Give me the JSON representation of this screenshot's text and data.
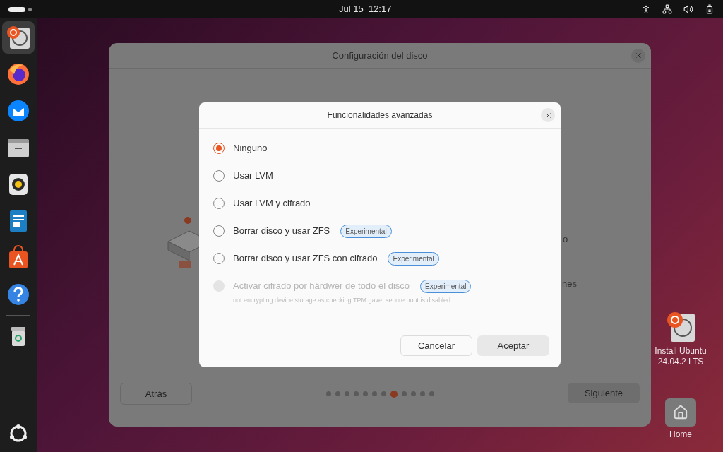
{
  "top_bar": {
    "clock": "Jul 15  12:17"
  },
  "dock": {
    "items": [
      {
        "kind": "installer",
        "selected": true
      },
      {
        "kind": "browser",
        "selected": false
      },
      {
        "kind": "mail",
        "selected": false
      },
      {
        "kind": "files",
        "selected": false
      },
      {
        "kind": "music",
        "selected": false
      },
      {
        "kind": "writer",
        "selected": false
      },
      {
        "kind": "store",
        "selected": false
      },
      {
        "kind": "help",
        "selected": false
      },
      {
        "kind": "trash",
        "selected": false
      }
    ]
  },
  "desktop_icons": [
    {
      "kind": "installer",
      "label": "Install Ubuntu\n24.04.2 LTS"
    },
    {
      "kind": "home",
      "label": "Home"
    }
  ],
  "window": {
    "title": "Configuración del disco",
    "background_fragments": [
      "o",
      "nes"
    ],
    "back_button": "Atrás",
    "next_button": "Siguiente",
    "pages": [
      {
        "selected": false
      },
      {
        "selected": false
      },
      {
        "selected": false
      },
      {
        "selected": false
      },
      {
        "selected": false
      },
      {
        "selected": false
      },
      {
        "selected": false
      },
      {
        "selected": true
      },
      {
        "selected": false
      },
      {
        "selected": false
      },
      {
        "selected": false
      },
      {
        "selected": false
      }
    ]
  },
  "dialog": {
    "title": "Funcionalidades avanzadas",
    "options": [
      {
        "label": "Ninguno",
        "selected": true,
        "disabled": false
      },
      {
        "label": "Usar LVM",
        "selected": false,
        "disabled": false
      },
      {
        "label": "Usar LVM y cifrado",
        "selected": false,
        "disabled": false
      },
      {
        "label": "Borrar disco y usar ZFS",
        "selected": false,
        "disabled": false,
        "badge": "Experimental"
      },
      {
        "label": "Borrar disco y usar ZFS con cifrado",
        "selected": false,
        "disabled": false,
        "badge": "Experimental"
      },
      {
        "label": "Activar cifrado por hárdwer de todo el disco",
        "selected": false,
        "disabled": true,
        "badge": "Experimental",
        "note": "not encrypting device storage as checking TPM gave: secure boot is disabled"
      }
    ],
    "buttons": [
      "Cancelar",
      "Aceptar"
    ]
  }
}
